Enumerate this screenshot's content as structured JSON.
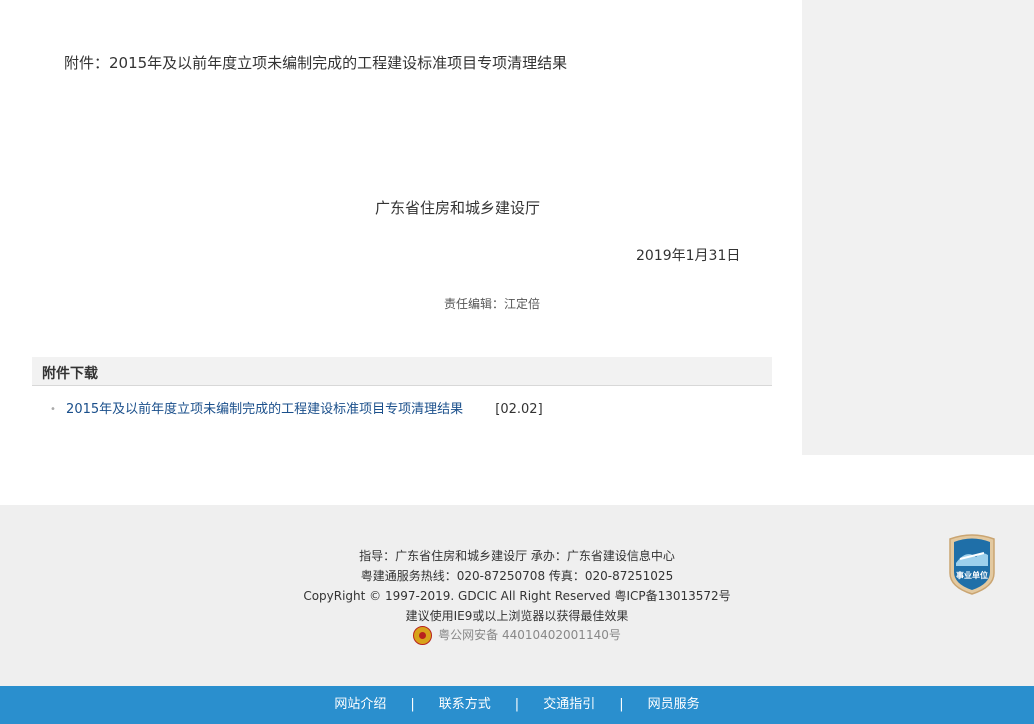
{
  "article": {
    "attachment_line": "附件：2015年及以前年度立项未编制完成的工程建设标准项目专项清理结果",
    "department": "广东省住房和城乡建设厅",
    "date": "2019年1月31日",
    "editor": "责任编辑：江定倍"
  },
  "downloads": {
    "title": "附件下载",
    "items": [
      {
        "name": "2015年及以前年度立项未编制完成的工程建设标准项目专项清理结果",
        "size": "[02.02]"
      }
    ]
  },
  "footer": {
    "guide_line": "指导：广东省住房和城乡建设厅   承办：广东省建设信息中心",
    "hotline_line": "粤建通服务热线：020-87250708   传真：020-87251025",
    "copyright_line": "CopyRight © 1997-2019. GDCIC All Right Reserved   粤ICP备13013572号",
    "browser_line": "建议使用IE9或以上浏览器以获得最佳效果",
    "gongan_line": "粤公网安备 44010402001140号",
    "badge_text": "事业单位"
  },
  "nav": {
    "items": [
      "网站介绍",
      "联系方式",
      "交通指引",
      "网员服务"
    ],
    "separator": "|"
  },
  "colors": {
    "nav_bg": "#2a8fce",
    "link": "#1a4f8b",
    "footer_bg": "#efefef",
    "side_panel": "#f1f1f1"
  }
}
